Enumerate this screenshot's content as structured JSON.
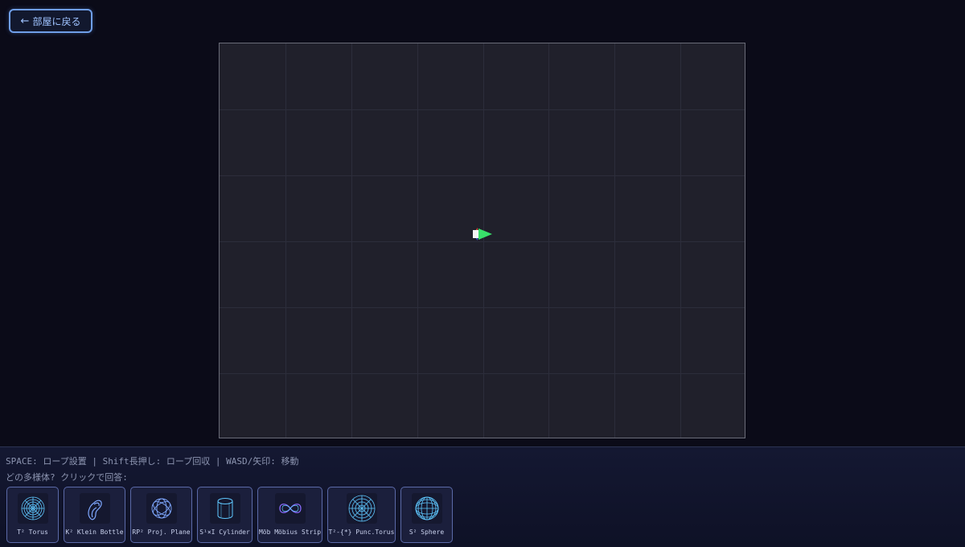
{
  "back_button": {
    "label": "部屋に戻る",
    "arrow": "←"
  },
  "canvas": {
    "grid_columns": 8,
    "grid_rows": 6,
    "player": {
      "icon": "player-arrow-icon",
      "colors": [
        "#38e06a",
        "#e0483a",
        "#3a5ae0",
        "#ffffff"
      ]
    }
  },
  "controls_text": "SPACE: ロープ設置 | Shift長押し: ロープ回収 | WASD/矢印: 移動",
  "question": "どの多様体? クリックで回答:",
  "choices": [
    {
      "label": "T² Torus",
      "icon": "torus-icon"
    },
    {
      "label": "K² Klein Bottle",
      "icon": "klein-bottle-icon"
    },
    {
      "label": "RP² Proj. Plane",
      "icon": "projective-plane-icon"
    },
    {
      "label": "S¹×I Cylinder",
      "icon": "cylinder-icon"
    },
    {
      "label": "Möb Möbius Strip",
      "icon": "mobius-strip-icon"
    },
    {
      "label": "T²-{*} Punc.Torus",
      "icon": "punctured-torus-icon"
    },
    {
      "label": "S² Sphere",
      "icon": "sphere-icon"
    }
  ],
  "colors": {
    "accent": "#6f9ee8",
    "icon_stroke": "#5fc8ff"
  }
}
